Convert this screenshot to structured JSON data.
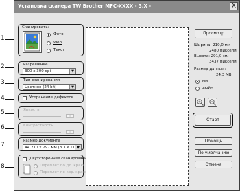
{
  "window": {
    "title": "Установка сканера TW Brother MFC-XXXX  - 3.X -",
    "close": "X"
  },
  "callouts": [
    "1",
    "2",
    "3",
    "4",
    "5",
    "6",
    "7",
    "8"
  ],
  "scan": {
    "label": "Сканировать:",
    "options": [
      "Фото",
      "Web",
      "Текст"
    ],
    "selected": "Фото"
  },
  "resolution": {
    "label": "Разрешение",
    "value": "300 x 300 dpi"
  },
  "scan_type": {
    "label": "Тип сканирования",
    "value": "Цветное (24 bit)"
  },
  "defects": {
    "label": "Устранение дефектов"
  },
  "brightness": {
    "label": "Яркость",
    "value": "0"
  },
  "contrast": {
    "label": "Контрастность",
    "value": "0"
  },
  "doc_size": {
    "label": "Размер документа",
    "value": "A4 210 x 297 мм (8.3 x 11..."
  },
  "duplex": {
    "label": "Двухстороннее сканирование",
    "long_edge": "Переплет по дл. краю",
    "short_edge": "Переплет по кор. краю"
  },
  "right": {
    "preview": "Просмотр",
    "width_label": "Ширина: 210,0 мм",
    "width_px": "2480 пиксели",
    "height_label": "Высота: 291,0 мм",
    "height_px": "3437 пиксели",
    "data_size_label": "Размер данных:",
    "data_size_value": "24,3 MB",
    "unit_mm": "мм",
    "unit_inch": "дюйм",
    "start": "Старт",
    "help": "Помощь",
    "default": "По умолчанию",
    "cancel": "Отмена"
  },
  "colors": {
    "titlebar": "#8a8a8a",
    "dialog": "#e6e6e6",
    "accent": "#000000"
  }
}
